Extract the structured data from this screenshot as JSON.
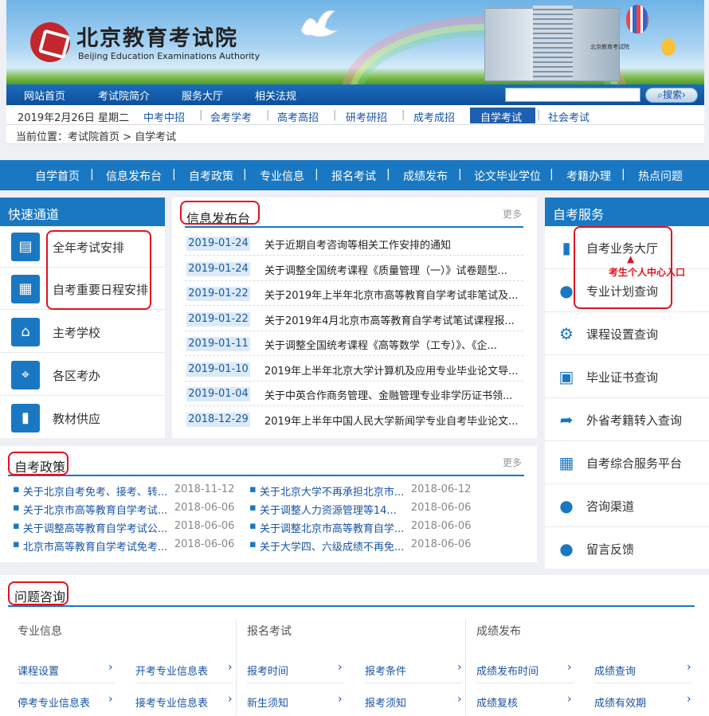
{
  "header": {
    "logo_cn": "北京教育考试院",
    "logo_en": "Beijing Education Examinations Authority",
    "building_sign": "北京教育考试院"
  },
  "topnav": [
    "网站首页",
    "考试院简介",
    "服务大厅",
    "相关法规"
  ],
  "search": {
    "button": "搜索"
  },
  "subnav": {
    "date": "2019年2月26日  星期二",
    "items": [
      "中考中招",
      "会考学考",
      "高考高招",
      "研考研招",
      "成考成招",
      "自学考试",
      "社会考试"
    ],
    "active": "自学考试"
  },
  "breadcrumb": "当前位置：考试院首页 > 自学考试",
  "mainnav": [
    "自学首页",
    "信息发布台",
    "自考政策",
    "专业信息",
    "报名考试",
    "成绩发布",
    "论文毕业学位",
    "考籍办理",
    "热点问题"
  ],
  "quick": {
    "title": "快速通道",
    "items": [
      {
        "label": "全年考试安排",
        "icon": "document-icon"
      },
      {
        "label": "自考重要日程安排",
        "icon": "calendar-icon"
      },
      {
        "label": "主考学校",
        "icon": "school-icon"
      },
      {
        "label": "各区考办",
        "icon": "location-icon"
      },
      {
        "label": "教材供应",
        "icon": "book-icon"
      }
    ]
  },
  "info": {
    "title": "信息发布台",
    "more": "更多",
    "items": [
      {
        "date": "2019-01-24",
        "title": "关于近期自考咨询等相关工作安排的通知"
      },
      {
        "date": "2019-01-24",
        "title": "关于调整全国统考课程《质量管理（一）》试卷题型..."
      },
      {
        "date": "2019-01-22",
        "title": "关于2019年上半年北京市高等教育自学考试非笔试及..."
      },
      {
        "date": "2019-01-22",
        "title": "关于2019年4月北京市高等教育自学考试笔试课程报..."
      },
      {
        "date": "2019-01-11",
        "title": "关于调整全国统考课程《高等数学（工专）》、《企..."
      },
      {
        "date": "2019-01-10",
        "title": "2019年上半年北京大学计算机及应用专业毕业论文导..."
      },
      {
        "date": "2019-01-04",
        "title": "关于中英合作商务管理、金融管理专业非学历证书领..."
      },
      {
        "date": "2018-12-29",
        "title": "2019年上半年中国人民大学新闻学专业自考毕业论文..."
      }
    ]
  },
  "service": {
    "title": "自考服务",
    "annotation": "考生个人中心入口",
    "items": [
      {
        "label": "自考业务大厅",
        "icon": "building-icon"
      },
      {
        "label": "专业计划查询",
        "icon": "magnifier-icon"
      },
      {
        "label": "课程设置查询",
        "icon": "gear-icon"
      },
      {
        "label": "毕业证书查询",
        "icon": "id-card-icon"
      },
      {
        "label": "外省考籍转入查询",
        "icon": "arrow-transfer-icon"
      },
      {
        "label": "自考综合服务平台",
        "icon": "grid-icon"
      },
      {
        "label": "咨询渠道",
        "icon": "person-icon"
      },
      {
        "label": "留言反馈",
        "icon": "chat-icon"
      }
    ]
  },
  "policy": {
    "title": "自考政策",
    "more": "更多",
    "items": [
      {
        "title": "关于北京自考免考、接考、转...",
        "date": "2018-11-12"
      },
      {
        "title": "关于北京大学不再承担北京市...",
        "date": "2018-06-12"
      },
      {
        "title": "关于北京市高等教育自学考试...",
        "date": "2018-06-06"
      },
      {
        "title": "关于调整人力资源管理等14...",
        "date": "2018-06-06"
      },
      {
        "title": "关于调整高等教育自学考试公...",
        "date": "2018-06-06"
      },
      {
        "title": "关于调整北京市高等教育自学...",
        "date": "2018-06-06"
      },
      {
        "title": "北京市高等教育自学考试免考...",
        "date": "2018-06-06"
      },
      {
        "title": "关于大学四、六级成绩不再免...",
        "date": "2018-06-06"
      }
    ]
  },
  "qa": {
    "title": "问题咨询",
    "columns": [
      {
        "head": "专业信息",
        "links": [
          "课程设置",
          "开考专业信息表",
          "停考专业信息表",
          "接考专业信息表"
        ]
      },
      {
        "head": "报名考试",
        "links": [
          "报考时间",
          "报考条件",
          "新生须知",
          "报考须知"
        ]
      },
      {
        "head": "成绩发布",
        "links": [
          "成绩发布时间",
          "成绩查询",
          "成绩复核",
          "成绩有效期"
        ]
      }
    ]
  }
}
